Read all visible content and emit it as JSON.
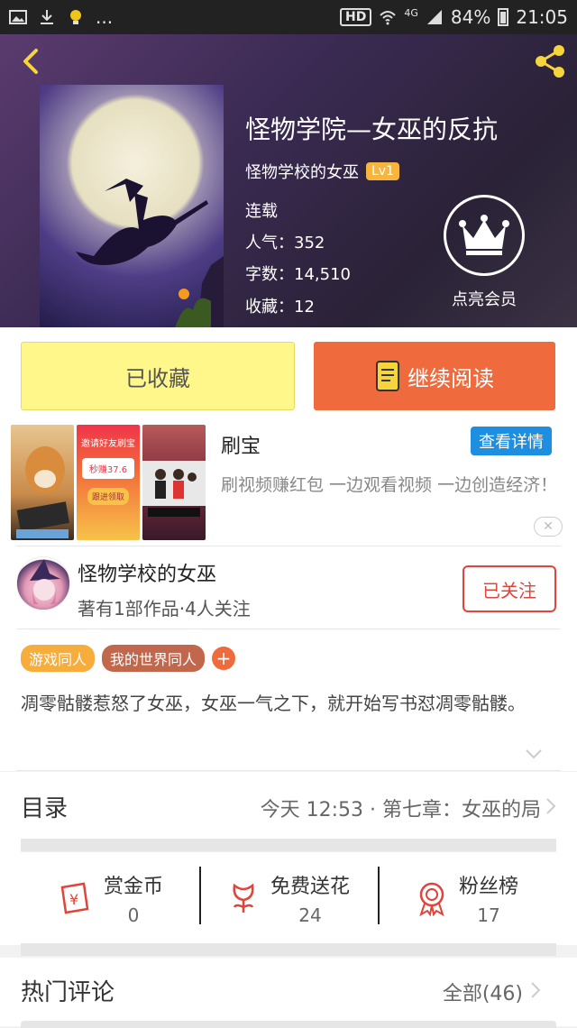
{
  "status_bar": {
    "network": "4G",
    "hd": "HD",
    "battery": "84%",
    "time": "21:05",
    "ellipsis": "..."
  },
  "book": {
    "title": "怪物学院—女巫的反抗",
    "author": "怪物学校的女巫",
    "level": "Lv1",
    "status": "连载",
    "popularity": "人气：352",
    "word_count": "字数：14,510",
    "favorites": "收藏：12",
    "vip_label": "点亮会员"
  },
  "actions": {
    "favorited_label": "已收藏",
    "continue_label": "继续阅读"
  },
  "ad": {
    "title": "刷宝",
    "button": "查看详情",
    "description": "刷视频赚红包 一边观看视频 一边创造经济！",
    "img2_top": "邀请好友刷宝",
    "img2_amount": "秒赚37.6",
    "img2_btn": "跟进领取"
  },
  "author_info": {
    "name": "怪物学校的女巫",
    "summary": "著有1部作品·4人关注",
    "follow_label": "已关注"
  },
  "tags": [
    {
      "label": "游戏同人",
      "color": "#f6ad3c"
    },
    {
      "label": "我的世界同人",
      "color": "#c1674c"
    }
  ],
  "tag_add": "+",
  "description": "凋零骷髅惹怒了女巫，女巫一气之下，就开始写书怼凋零骷髅。",
  "toc": {
    "title": "目录",
    "latest": "今天 12:53 · 第七章：女巫的局"
  },
  "stats": [
    {
      "label": "赏金币",
      "value": "0",
      "icon": "coin-icon"
    },
    {
      "label": "免费送花",
      "value": "24",
      "icon": "flower-icon"
    },
    {
      "label": "粉丝榜",
      "value": "17",
      "icon": "medal-icon"
    }
  ],
  "comments": {
    "title": "热门评论",
    "all": "全部(46)"
  },
  "colors": {
    "accent": "#ef6a3c",
    "favorite": "#fff78a",
    "follow": "#e0443a",
    "ad_button": "#1e8ee0"
  }
}
